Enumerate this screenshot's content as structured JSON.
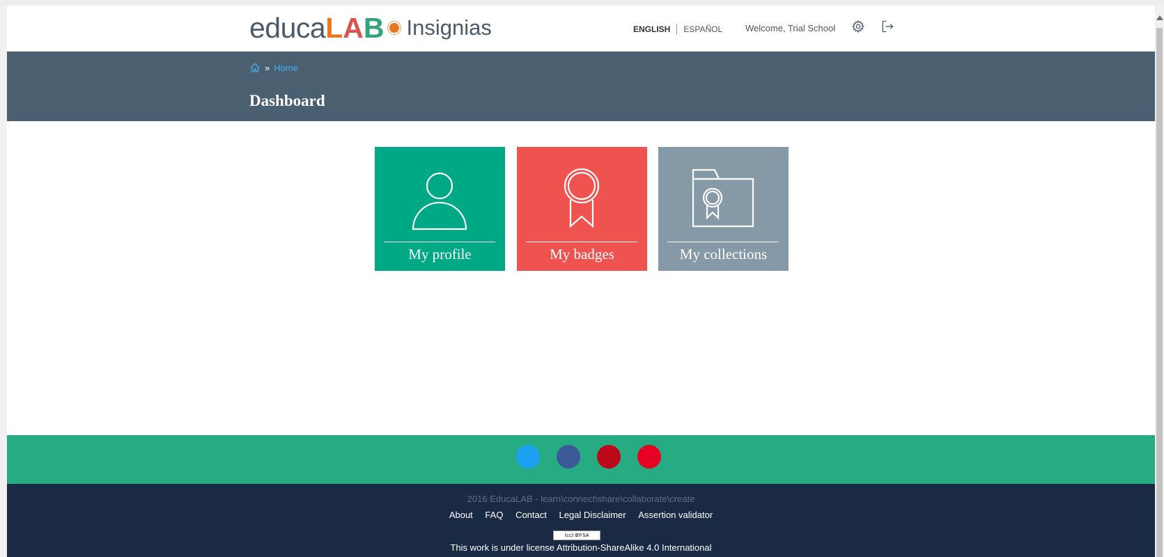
{
  "header": {
    "logo": {
      "educa": "educa",
      "lab_l": "L",
      "lab_a": "A",
      "lab_b": "B",
      "suffix": "Insignias"
    },
    "languages": {
      "english": "ENGLISH",
      "spanish": "ESPAÑOL"
    },
    "welcome": "Welcome, Trial School",
    "icons": {
      "settings": "gear-icon",
      "logout": "logout-icon"
    }
  },
  "breadcrumb": {
    "separator": "»",
    "current": "Home"
  },
  "page_title": "Dashboard",
  "tiles": [
    {
      "label": "My profile",
      "icon": "user-icon",
      "color": "#00a985"
    },
    {
      "label": "My badges",
      "icon": "badge-icon",
      "color": "#ef5350"
    },
    {
      "label": "My collections",
      "icon": "folder-badge-icon",
      "color": "#8599a6"
    }
  ],
  "social": [
    {
      "icon": "twitter-icon",
      "color": "#1da1f2"
    },
    {
      "icon": "facebook-icon",
      "color": "#3b5998"
    },
    {
      "icon": "pinterest-icon",
      "color": "#bd081c"
    },
    {
      "icon": "pinterest-alt-icon",
      "color": "#e60023"
    }
  ],
  "footer": {
    "copyright": "2016 EducaLAB - learn\\connect\\share\\collaborate\\create",
    "links": [
      "About",
      "FAQ",
      "Contact",
      "Legal Disclaimer",
      "Assertion validator"
    ],
    "cc_badge": "(cc) BY-SA",
    "license": "This work is under license Attribution-ShareAlike 4.0 International"
  },
  "colors": {
    "band": "#4a5f70",
    "social_bar": "#27ab82",
    "footer_bg": "#1b2a44",
    "link": "#42b0f5"
  }
}
